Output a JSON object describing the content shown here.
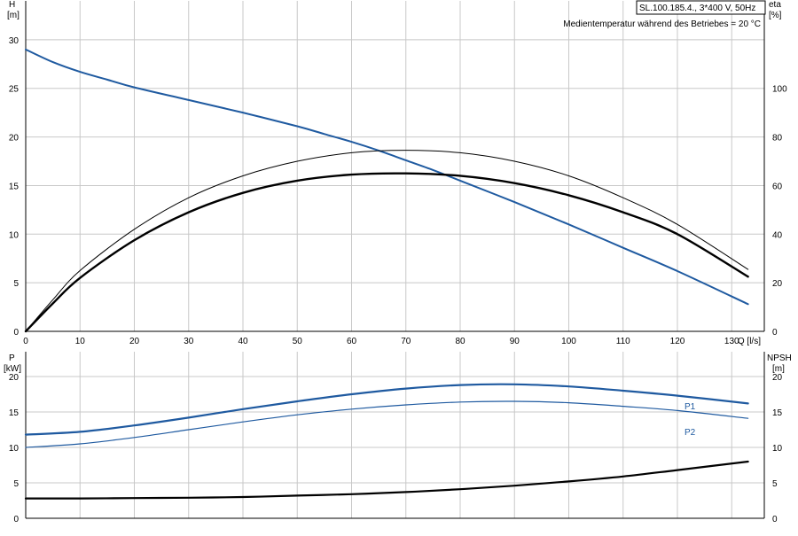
{
  "header": {
    "pump_label": "SL.100.185.4., 3*400 V, 50Hz",
    "temperature_note": "Medientemperatur während des Betriebes = 20 °C"
  },
  "chart_data": [
    {
      "type": "line",
      "x_label": "Q [l/s]",
      "y_left_label_top": "H",
      "y_left_label_bottom": "[m]",
      "y_right_label_top": "eta",
      "y_right_label_bottom": "[%]",
      "xlim": [
        0,
        136
      ],
      "x_ticks": [
        0,
        10,
        20,
        30,
        40,
        50,
        60,
        70,
        80,
        90,
        100,
        110,
        120,
        130
      ],
      "ylim_left": [
        0,
        34
      ],
      "y_left_ticks": [
        0,
        5,
        10,
        15,
        20,
        25,
        30
      ],
      "ylim_right": [
        0,
        136
      ],
      "y_right_ticks": [
        0,
        20,
        40,
        60,
        80,
        100
      ],
      "grid": true,
      "series": [
        {
          "axis": "left",
          "color": "#1f5aa0",
          "width": 2,
          "x": [
            0,
            5,
            10,
            15,
            20,
            30,
            40,
            50,
            55,
            60,
            65,
            70,
            75,
            80,
            90,
            100,
            110,
            120,
            133
          ],
          "y": [
            29,
            27.7,
            26.7,
            25.9,
            25.1,
            23.8,
            22.5,
            21.1,
            20.3,
            19.5,
            18.6,
            17.6,
            16.6,
            15.5,
            13.3,
            11.0,
            8.6,
            6.2,
            2.8
          ]
        },
        {
          "axis": "right",
          "color": "#000000",
          "width": 1,
          "x": [
            0,
            5,
            10,
            20,
            30,
            40,
            50,
            60,
            70,
            80,
            90,
            100,
            110,
            120,
            133
          ],
          "y": [
            0,
            13,
            25,
            42,
            55,
            64,
            70,
            73.5,
            74.5,
            73.5,
            70,
            64,
            55,
            44,
            25.5
          ]
        },
        {
          "axis": "right",
          "color": "#000000",
          "width": 2.4,
          "x": [
            0,
            5,
            10,
            20,
            30,
            40,
            50,
            60,
            70,
            80,
            90,
            100,
            110,
            120,
            133
          ],
          "y": [
            0,
            11.5,
            22,
            37.5,
            49,
            57,
            62,
            64.5,
            65,
            64,
            61,
            56,
            49,
            40,
            22.5
          ]
        }
      ]
    },
    {
      "type": "line",
      "y_left_label_top": "P",
      "y_left_label_bottom": "[kW]",
      "y_right_label_top": "NPSH",
      "y_right_label_bottom": "[m]",
      "xlim": [
        0,
        136
      ],
      "ylim": [
        0,
        23.5
      ],
      "y_ticks": [
        0,
        5,
        10,
        15,
        20
      ],
      "grid": true,
      "series": [
        {
          "name": "P1",
          "color": "#1f5aa0",
          "width": 2.2,
          "x": [
            0,
            10,
            20,
            30,
            40,
            50,
            60,
            70,
            80,
            90,
            100,
            110,
            120,
            133
          ],
          "y": [
            11.8,
            12.2,
            13.1,
            14.2,
            15.4,
            16.5,
            17.5,
            18.3,
            18.8,
            18.9,
            18.6,
            18.0,
            17.3,
            16.2
          ]
        },
        {
          "name": "P2",
          "color": "#1f5aa0",
          "width": 1.2,
          "x": [
            0,
            10,
            20,
            30,
            40,
            50,
            60,
            70,
            80,
            90,
            100,
            110,
            120,
            133
          ],
          "y": [
            10.0,
            10.5,
            11.4,
            12.5,
            13.6,
            14.6,
            15.4,
            16.0,
            16.4,
            16.5,
            16.3,
            15.8,
            15.2,
            14.1
          ]
        },
        {
          "color": "#000000",
          "width": 2.2,
          "x": [
            0,
            10,
            20,
            30,
            40,
            50,
            60,
            70,
            80,
            90,
            100,
            110,
            120,
            133
          ],
          "y": [
            2.8,
            2.8,
            2.85,
            2.9,
            3.0,
            3.2,
            3.4,
            3.7,
            4.1,
            4.6,
            5.2,
            5.9,
            6.8,
            8.0
          ]
        }
      ]
    }
  ]
}
